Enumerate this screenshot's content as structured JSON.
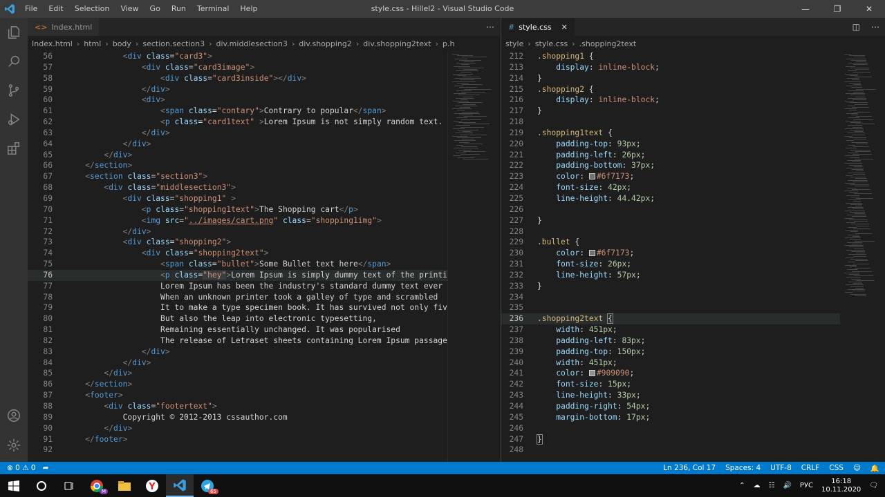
{
  "window": {
    "title": "style.css - Hillel2 - Visual Studio Code",
    "menu": [
      "File",
      "Edit",
      "Selection",
      "View",
      "Go",
      "Run",
      "Terminal",
      "Help"
    ]
  },
  "left_editor": {
    "tab": {
      "label": "Index.html",
      "icon": "<>"
    },
    "breadcrumbs": [
      "Index.html",
      "html",
      "body",
      "section.section3",
      "div.middlesection3",
      "div.shopping2",
      "div.shopping2text",
      "p.h"
    ],
    "lines": [
      {
        "n": "56",
        "i": 3,
        "h": "<span class=\"p\">&lt;</span><span class=\"t\">div</span> <span class=\"a\">class</span><span class=\"x\">=</span><span class=\"s\">\"card3\"</span><span class=\"p\">&gt;</span>"
      },
      {
        "n": "57",
        "i": 4,
        "h": "<span class=\"p\">&lt;</span><span class=\"t\">div</span> <span class=\"a\">class</span><span class=\"x\">=</span><span class=\"s\">\"card3image\"</span><span class=\"p\">&gt;</span>"
      },
      {
        "n": "58",
        "i": 5,
        "h": "<span class=\"p\">&lt;</span><span class=\"t\">div</span> <span class=\"a\">class</span><span class=\"x\">=</span><span class=\"s\">\"card3inside\"</span><span class=\"p\">&gt;&lt;/</span><span class=\"t\">div</span><span class=\"p\">&gt;</span>"
      },
      {
        "n": "59",
        "i": 4,
        "h": "<span class=\"p\">&lt;/</span><span class=\"t\">div</span><span class=\"p\">&gt;</span>"
      },
      {
        "n": "60",
        "i": 4,
        "h": "<span class=\"p\">&lt;</span><span class=\"t\">div</span><span class=\"p\">&gt;</span>"
      },
      {
        "n": "61",
        "i": 5,
        "h": "<span class=\"p\">&lt;</span><span class=\"t\">span</span> <span class=\"a\">class</span><span class=\"x\">=</span><span class=\"s\">\"contary\"</span><span class=\"p\">&gt;</span><span class=\"x\">Contrary to popular</span><span class=\"p\">&lt;/</span><span class=\"t\">span</span><span class=\"p\">&gt;</span>"
      },
      {
        "n": "62",
        "i": 5,
        "h": "<span class=\"p\">&lt;</span><span class=\"t\">p</span> <span class=\"a\">class</span><span class=\"x\">=</span><span class=\"s\">\"card1text\"</span> <span class=\"p\">&gt;</span><span class=\"x\">Lorem Ipsum is not simply random text. It ha</span>"
      },
      {
        "n": "63",
        "i": 4,
        "h": "<span class=\"p\">&lt;/</span><span class=\"t\">div</span><span class=\"p\">&gt;</span>"
      },
      {
        "n": "64",
        "i": 3,
        "h": "<span class=\"p\">&lt;/</span><span class=\"t\">div</span><span class=\"p\">&gt;</span>"
      },
      {
        "n": "65",
        "i": 2,
        "h": "<span class=\"p\">&lt;/</span><span class=\"t\">div</span><span class=\"p\">&gt;</span>"
      },
      {
        "n": "66",
        "i": 1,
        "h": "<span class=\"p\">&lt;/</span><span class=\"t\">section</span><span class=\"p\">&gt;</span>"
      },
      {
        "n": "67",
        "i": 1,
        "h": "<span class=\"p\">&lt;</span><span class=\"t\">section</span> <span class=\"a\">class</span><span class=\"x\">=</span><span class=\"s\">\"section3\"</span><span class=\"p\">&gt;</span>"
      },
      {
        "n": "68",
        "i": 2,
        "h": "<span class=\"p\">&lt;</span><span class=\"t\">div</span> <span class=\"a\">class</span><span class=\"x\">=</span><span class=\"s\">\"middlesection3\"</span><span class=\"p\">&gt;</span>"
      },
      {
        "n": "69",
        "i": 3,
        "h": "<span class=\"p\">&lt;</span><span class=\"t\">div</span> <span class=\"a\">class</span><span class=\"x\">=</span><span class=\"s\">\"shopping1\"</span> <span class=\"p\">&gt;</span>"
      },
      {
        "n": "70",
        "i": 4,
        "h": "<span class=\"p\">&lt;</span><span class=\"t\">p</span> <span class=\"a\">class</span><span class=\"x\">=</span><span class=\"s\">\"shopping1text\"</span><span class=\"p\">&gt;</span><span class=\"x\">The Shopping cart</span><span class=\"p\">&lt;/</span><span class=\"t\">p</span><span class=\"p\">&gt;</span>"
      },
      {
        "n": "71",
        "i": 4,
        "h": "<span class=\"p\">&lt;</span><span class=\"t\">img</span> <span class=\"a\">src</span><span class=\"x\">=</span><span class=\"s\">\"<u>../images/cart.png</u>\"</span> <span class=\"a\">class</span><span class=\"x\">=</span><span class=\"s\">\"shopping1img\"</span><span class=\"p\">&gt;</span>"
      },
      {
        "n": "72",
        "i": 3,
        "h": "<span class=\"p\">&lt;/</span><span class=\"t\">div</span><span class=\"p\">&gt;</span>"
      },
      {
        "n": "73",
        "i": 3,
        "h": "<span class=\"p\">&lt;</span><span class=\"t\">div</span> <span class=\"a\">class</span><span class=\"x\">=</span><span class=\"s\">\"shopping2\"</span><span class=\"p\">&gt;</span>"
      },
      {
        "n": "74",
        "i": 4,
        "h": "<span class=\"p\">&lt;</span><span class=\"t\">div</span> <span class=\"a\">class</span><span class=\"x\">=</span><span class=\"s\">\"shopping2text\"</span><span class=\"p\">&gt;</span>"
      },
      {
        "n": "75",
        "i": 5,
        "h": "<span class=\"p\">&lt;</span><span class=\"t\">span</span> <span class=\"a\">class</span><span class=\"x\">=</span><span class=\"s\">\"bullet\"</span><span class=\"p\">&gt;</span><span class=\"x\">Some Bullet text here</span><span class=\"p\">&lt;/</span><span class=\"t\">span</span><span class=\"p\">&gt;</span>"
      },
      {
        "n": "76",
        "i": 5,
        "cur": true,
        "h": "<span class=\"p\">&lt;</span><span class=\"t\">p</span> <span class=\"a\">class</span><span class=\"x\">=</span><span class=\"s\" style=\"background:#3a3d41\">\"hey\"</span><span class=\"p\">&gt;</span><span class=\"x\">Lorem Ipsum is simply dummy text of the printing an</span>"
      },
      {
        "n": "77",
        "i": 5,
        "h": "<span class=\"x\">Lorem Ipsum has been the industry's standard dummy text ever</span>"
      },
      {
        "n": "78",
        "i": 5,
        "h": "<span class=\"x\">When an unknown printer took a galley of type and scrambled</span>"
      },
      {
        "n": "79",
        "i": 5,
        "h": "<span class=\"x\">It to make a type specimen book. It has survived not only five cen</span>"
      },
      {
        "n": "80",
        "i": 5,
        "h": "<span class=\"x\">But also the leap into electronic typesetting,</span>"
      },
      {
        "n": "81",
        "i": 5,
        "h": "<span class=\"x\">Remaining essentially unchanged. It was popularised</span>"
      },
      {
        "n": "82",
        "i": 5,
        "h": "<span class=\"x\">The release of Letraset sheets containing Lorem Ipsum passages</span><span class=\"p\">&lt;/</span><span class=\"t\">p</span><span class=\"p\">&gt;</span>"
      },
      {
        "n": "83",
        "i": 4,
        "h": "<span class=\"p\">&lt;/</span><span class=\"t\">div</span><span class=\"p\">&gt;</span>"
      },
      {
        "n": "84",
        "i": 3,
        "h": "<span class=\"p\">&lt;/</span><span class=\"t\">div</span><span class=\"p\">&gt;</span>"
      },
      {
        "n": "85",
        "i": 2,
        "h": "<span class=\"p\">&lt;/</span><span class=\"t\">div</span><span class=\"p\">&gt;</span>"
      },
      {
        "n": "86",
        "i": 1,
        "h": "<span class=\"p\">&lt;/</span><span class=\"t\">section</span><span class=\"p\">&gt;</span>"
      },
      {
        "n": "87",
        "i": 1,
        "h": "<span class=\"p\">&lt;</span><span class=\"t\">footer</span><span class=\"p\">&gt;</span>"
      },
      {
        "n": "88",
        "i": 2,
        "h": "<span class=\"p\">&lt;</span><span class=\"t\">div</span> <span class=\"a\">class</span><span class=\"x\">=</span><span class=\"s\">\"footertext\"</span><span class=\"p\">&gt;</span>"
      },
      {
        "n": "89",
        "i": 3,
        "h": "<span class=\"x\">Copyright © 2012-2013 cssauthor.com</span>"
      },
      {
        "n": "90",
        "i": 2,
        "h": "<span class=\"p\">&lt;/</span><span class=\"t\">div</span><span class=\"p\">&gt;</span>"
      },
      {
        "n": "91",
        "i": 1,
        "h": "<span class=\"p\">&lt;/</span><span class=\"t\">footer</span><span class=\"p\">&gt;</span>"
      },
      {
        "n": "92",
        "i": 0,
        "h": ""
      }
    ]
  },
  "right_editor": {
    "tab": {
      "label": "style.css",
      "icon": "#"
    },
    "breadcrumbs": [
      "style",
      "style.css",
      ".shopping2text"
    ],
    "lines": [
      {
        "n": "212",
        "h": "<span class=\"sel\">.shopping1</span> <span class=\"x\">{</span>"
      },
      {
        "n": "213",
        "h": "    <span class=\"prop\">display</span><span class=\"x\">: </span><span class=\"val\">inline-block</span><span class=\"x\">;</span>"
      },
      {
        "n": "214",
        "h": "<span class=\"x\">}</span>"
      },
      {
        "n": "215",
        "h": "<span class=\"sel\">.shopping2</span> <span class=\"x\">{</span>"
      },
      {
        "n": "216",
        "h": "    <span class=\"prop\">display</span><span class=\"x\">: </span><span class=\"val\">inline-block</span><span class=\"x\">;</span>"
      },
      {
        "n": "217",
        "h": "<span class=\"x\">}</span>"
      },
      {
        "n": "218",
        "h": ""
      },
      {
        "n": "219",
        "h": "<span class=\"sel\">.shopping1text</span> <span class=\"x\">{</span>"
      },
      {
        "n": "220",
        "h": "    <span class=\"prop\">padding-top</span><span class=\"x\">: </span><span class=\"num\">93px</span><span class=\"x\">;</span>"
      },
      {
        "n": "221",
        "h": "    <span class=\"prop\">padding-left</span><span class=\"x\">: </span><span class=\"num\">26px</span><span class=\"x\">;</span>"
      },
      {
        "n": "222",
        "h": "    <span class=\"prop\">padding-bottom</span><span class=\"x\">: </span><span class=\"num\">37px</span><span class=\"x\">;</span>"
      },
      {
        "n": "223",
        "h": "    <span class=\"prop\">color</span><span class=\"x\">: </span><span class=\"sw\" style=\"background:#6f7173\"></span><span class=\"val\">#6f7173</span><span class=\"x\">;</span>"
      },
      {
        "n": "224",
        "h": "    <span class=\"prop\">font-size</span><span class=\"x\">: </span><span class=\"num\">42px</span><span class=\"x\">;</span>"
      },
      {
        "n": "225",
        "h": "    <span class=\"prop\">line-height</span><span class=\"x\">: </span><span class=\"num\">44.42px</span><span class=\"x\">;</span>"
      },
      {
        "n": "226",
        "h": ""
      },
      {
        "n": "227",
        "h": "<span class=\"x\">}</span>"
      },
      {
        "n": "228",
        "h": ""
      },
      {
        "n": "229",
        "h": "<span class=\"sel\">.bullet</span> <span class=\"x\">{</span>"
      },
      {
        "n": "230",
        "h": "    <span class=\"prop\">color</span><span class=\"x\">: </span><span class=\"sw\" style=\"background:#6f7173\"></span><span class=\"val\">#6f7173</span><span class=\"x\">;</span>"
      },
      {
        "n": "231",
        "h": "    <span class=\"prop\">font-size</span><span class=\"x\">: </span><span class=\"num\">26px</span><span class=\"x\">;</span>"
      },
      {
        "n": "232",
        "h": "    <span class=\"prop\">line-height</span><span class=\"x\">: </span><span class=\"num\">57px</span><span class=\"x\">;</span>"
      },
      {
        "n": "233",
        "h": "<span class=\"x\">}</span>"
      },
      {
        "n": "234",
        "h": ""
      },
      {
        "n": "235",
        "h": ""
      },
      {
        "n": "236",
        "cur": true,
        "h": "<span class=\"sel\">.shopping2text</span> <span class=\"x\" style=\"outline:1px solid #888\">{</span>"
      },
      {
        "n": "237",
        "h": "    <span class=\"prop\">width</span><span class=\"x\">: </span><span class=\"num\">451px</span><span class=\"x\">;</span>"
      },
      {
        "n": "238",
        "h": "    <span class=\"prop\">padding-left</span><span class=\"x\">: </span><span class=\"num\">83px</span><span class=\"x\">;</span>"
      },
      {
        "n": "239",
        "h": "    <span class=\"prop\">padding-top</span><span class=\"x\">: </span><span class=\"num\">150px</span><span class=\"x\">;</span>"
      },
      {
        "n": "240",
        "h": "    <span class=\"prop\">width</span><span class=\"x\">: </span><span class=\"num\">451px</span><span class=\"x\">;</span>"
      },
      {
        "n": "241",
        "h": "    <span class=\"prop\">color</span><span class=\"x\">: </span><span class=\"sw\" style=\"background:#909090\"></span><span class=\"val\">#909090</span><span class=\"x\">;</span>"
      },
      {
        "n": "242",
        "h": "    <span class=\"prop\">font-size</span><span class=\"x\">: </span><span class=\"num\">15px</span><span class=\"x\">;</span>"
      },
      {
        "n": "243",
        "h": "    <span class=\"prop\">line-height</span><span class=\"x\">: </span><span class=\"num\">33px</span><span class=\"x\">;</span>"
      },
      {
        "n": "244",
        "h": "    <span class=\"prop\">padding-right</span><span class=\"x\">: </span><span class=\"num\">54px</span><span class=\"x\">;</span>"
      },
      {
        "n": "245",
        "h": "    <span class=\"prop\">margin-bottom</span><span class=\"x\">: </span><span class=\"num\">17px</span><span class=\"x\">;</span>"
      },
      {
        "n": "246",
        "h": ""
      },
      {
        "n": "247",
        "h": "<span class=\"x\" style=\"outline:1px solid #888\">}</span>"
      },
      {
        "n": "248",
        "h": ""
      }
    ]
  },
  "statusbar": {
    "errors": "0",
    "warnings": "0",
    "position": "Ln 236, Col 17",
    "spaces": "Spaces: 4",
    "encoding": "UTF-8",
    "eol": "CRLF",
    "language": "CSS"
  },
  "taskbar": {
    "lang": "РУС",
    "time": "16:18",
    "date": "10.11.2020",
    "telegram_badge": "65"
  },
  "colors": {
    "accent": "#007acc",
    "background": "#1e1e1e",
    "activity_bar": "#333333"
  }
}
